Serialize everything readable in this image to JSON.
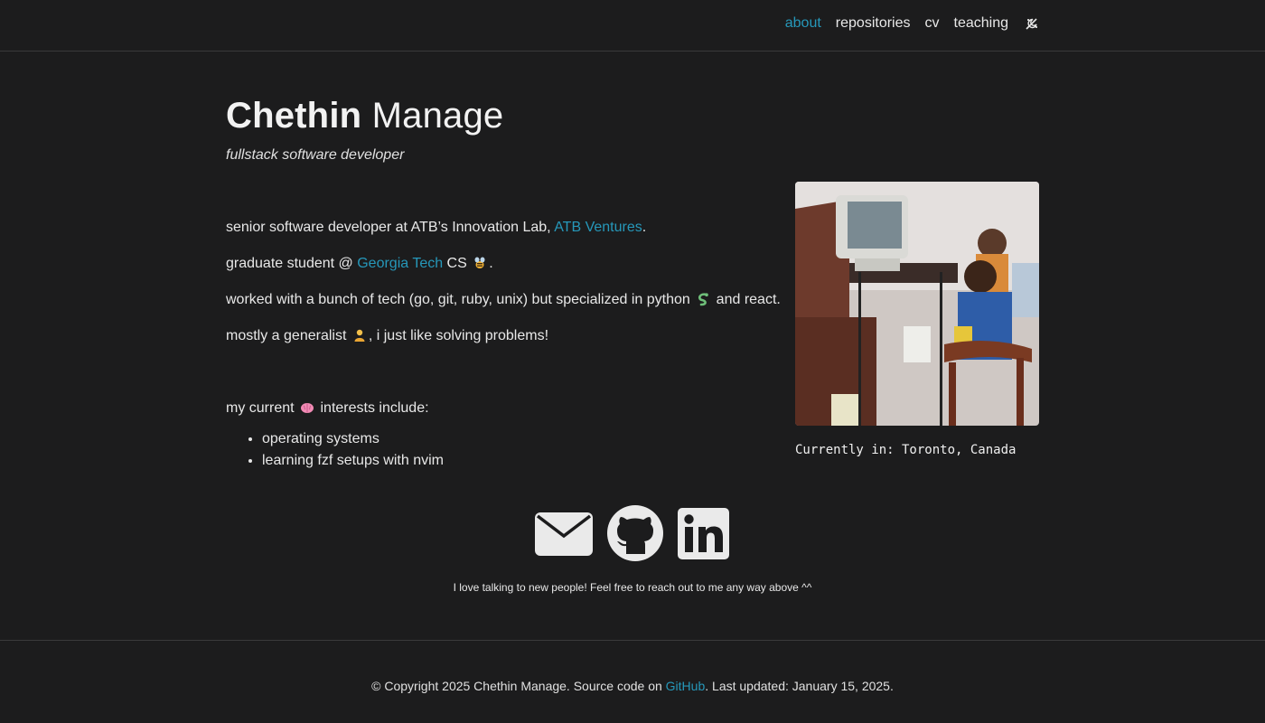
{
  "nav": {
    "items": [
      {
        "label": "about",
        "active": true
      },
      {
        "label": "repositories",
        "active": false
      },
      {
        "label": "cv",
        "active": false
      },
      {
        "label": "teaching",
        "active": false
      }
    ],
    "theme_toggle_icon": "theme-toggle-icon"
  },
  "header": {
    "first_name": "Chethin",
    "last_name": "Manage",
    "subtitle": "fullstack software developer"
  },
  "about": {
    "line1_prefix": "senior software developer at ATB’s Innovation Lab, ",
    "line1_link": "ATB Ventures",
    "line1_suffix": ".",
    "line2_prefix": "graduate student @ ",
    "line2_link": "Georgia Tech",
    "line2_suffix": " CS",
    "line2_end": ".",
    "line3_prefix": "worked with a bunch of tech (go, git, ruby, unix) but specialized in python",
    "line3_suffix": "and react.",
    "line4_prefix": "mostly a generalist",
    "line4_suffix": ", i just like solving problems!",
    "interests_prefix": "my current",
    "interests_suffix": "interests include:",
    "interests": [
      "operating systems",
      "learning fzf setups with nvim"
    ]
  },
  "profile": {
    "location": "Currently in: Toronto, Canada"
  },
  "social": {
    "icons": [
      "email-icon",
      "github-icon",
      "linkedin-icon"
    ],
    "note": "I love talking to new people! Feel free to reach out to me any way above ^^"
  },
  "footer": {
    "prefix": "© Copyright 2025 Chethin Manage. Source code on ",
    "link": "GitHub",
    "suffix": ". Last updated: January 15, 2025."
  },
  "colors": {
    "background": "#1c1c1d",
    "accent": "#2698ba",
    "text": "#e8e8e8"
  }
}
